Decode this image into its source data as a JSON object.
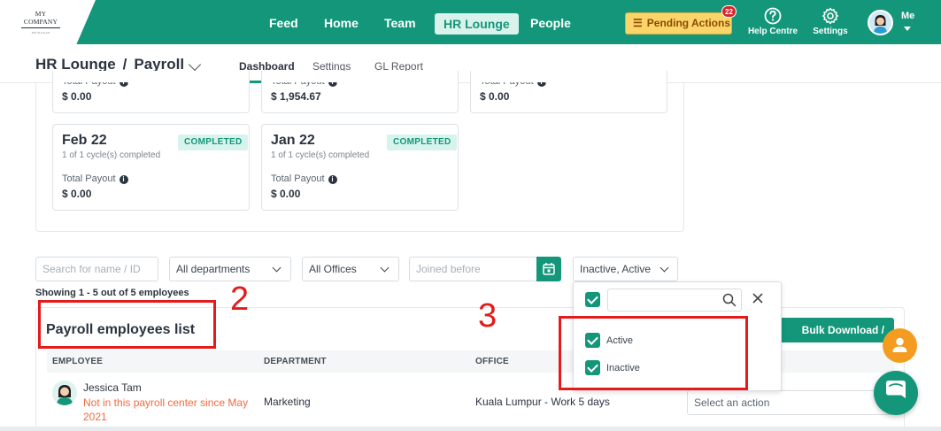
{
  "brand": {
    "logo_text": "MY COMPANY",
    "logo_sub": "MY SLOGAN"
  },
  "nav": {
    "items": [
      {
        "label": "Feed"
      },
      {
        "label": "Home"
      },
      {
        "label": "Team"
      },
      {
        "label": "HR Lounge",
        "active": true
      },
      {
        "label": "People"
      }
    ],
    "pending_label": "Pending Actions",
    "pending_count": "22",
    "help_label": "Help Centre",
    "settings_label": "Settings",
    "me_label": "Me"
  },
  "page": {
    "breadcrumb_root": "HR Lounge",
    "breadcrumb_sep": "/",
    "breadcrumb_current": "Payroll",
    "tabs": [
      {
        "label": "Dashboard",
        "active": true
      },
      {
        "label": "Settings"
      },
      {
        "label": "GL Report"
      }
    ]
  },
  "cards": [
    {
      "total_label": "Total Payout",
      "amount": "$ 0.00"
    },
    {
      "total_label": "Total Payout",
      "amount": "$ 1,954.67"
    },
    {
      "total_label": "Total Payout",
      "amount": "$ 0.00"
    },
    {
      "month": "Feb 22",
      "status": "COMPLETED",
      "cycles": "1 of 1 cycle(s) completed",
      "total_label": "Total Payout",
      "amount": "$ 0.00"
    },
    {
      "month": "Jan 22",
      "status": "COMPLETED",
      "cycles": "1 of 1 cycle(s) completed",
      "total_label": "Total Payout",
      "amount": "$ 0.00"
    }
  ],
  "filters": {
    "search_placeholder": "Search for name / ID",
    "department": "All departments",
    "office": "All Offices",
    "joined_placeholder": "Joined before",
    "status": "Inactive, Active"
  },
  "list": {
    "showing": "Showing 1 - 5 out of 5 employees",
    "title": "Payroll employees list",
    "bulk_button": "Bulk Download / Upload",
    "columns": [
      "EMPLOYEE",
      "DEPARTMENT",
      "OFFICE"
    ],
    "rows": [
      {
        "name": "Jessica Tam",
        "warning": "Not in this payroll center since May 2021",
        "department": "Marketing",
        "office": "Kuala Lumpur - Work 5 days",
        "action": "Select an action"
      }
    ]
  },
  "status_dropdown": {
    "options": [
      {
        "label": "Active",
        "checked": true
      },
      {
        "label": "Inactive",
        "checked": true
      }
    ]
  },
  "annotations": {
    "num_2": "2",
    "num_3": "3"
  },
  "colors": {
    "brand_green": "#14967a",
    "pending_bg": "#fbd56a",
    "warning_text": "#f06b3f",
    "annotation_red": "#e31b1b"
  }
}
